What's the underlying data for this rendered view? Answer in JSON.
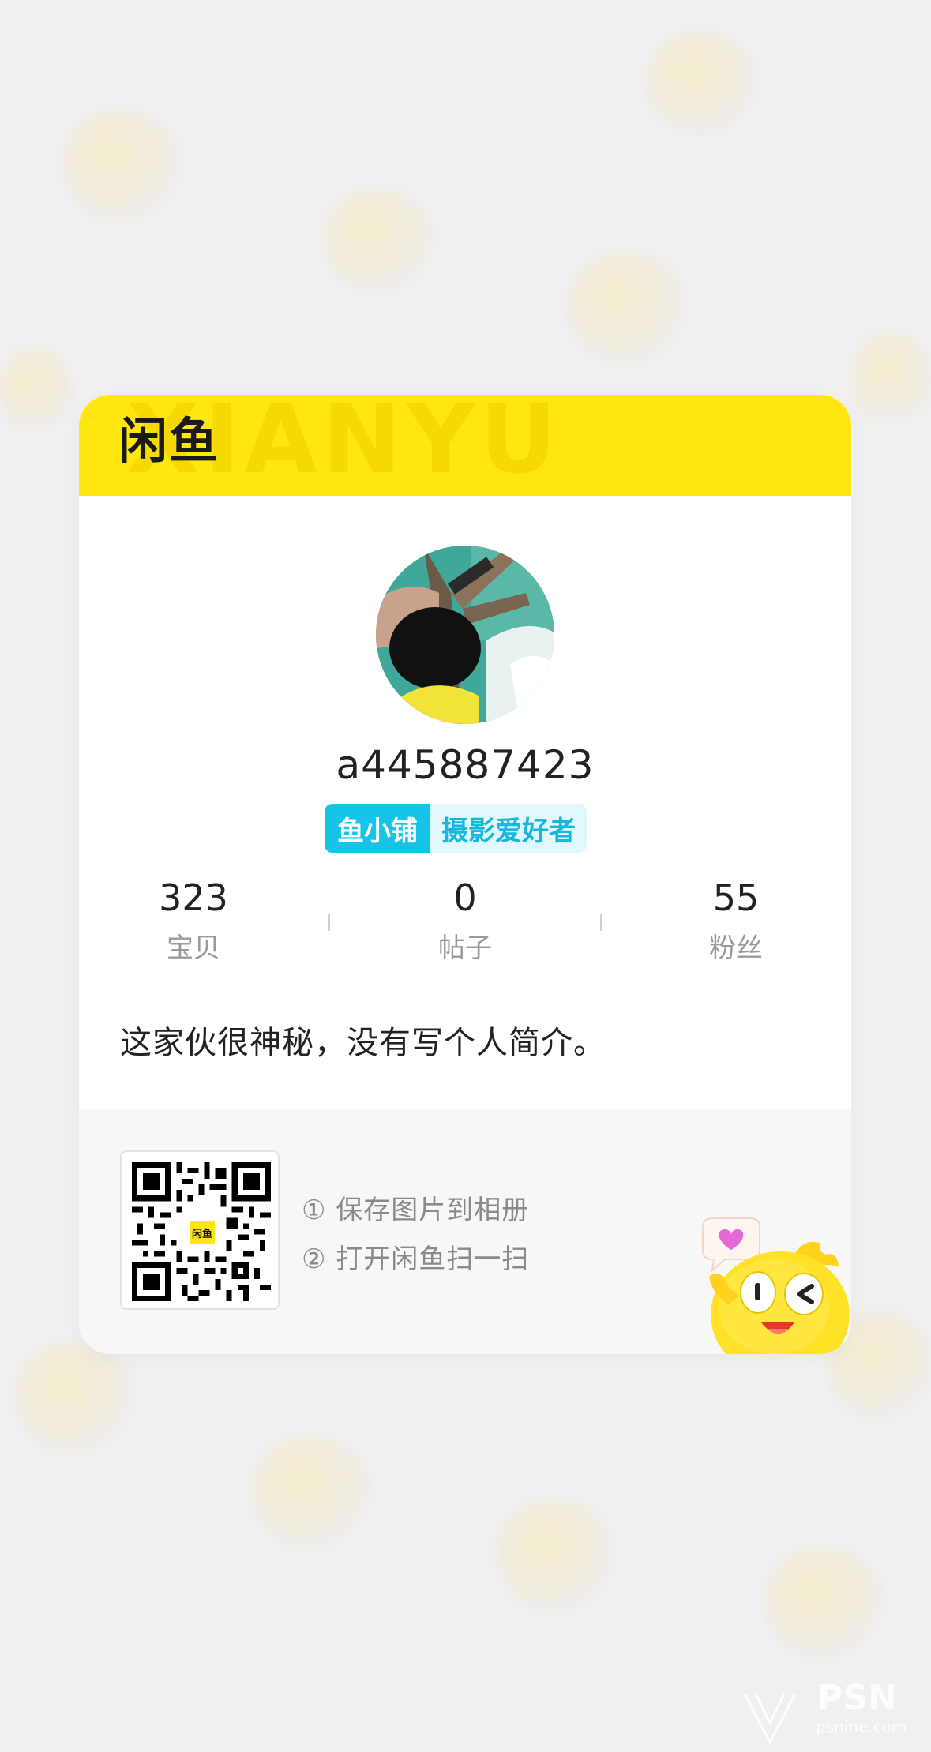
{
  "card": {
    "logo_text": "闲鱼",
    "header_watermark": "XIANYU",
    "username": "a445887423",
    "badge": {
      "shop_label": "鱼小铺",
      "tag_label": "摄影爱好者"
    },
    "stats": [
      {
        "value": "323",
        "label": "宝贝"
      },
      {
        "value": "0",
        "label": "帖子"
      },
      {
        "value": "55",
        "label": "粉丝"
      }
    ],
    "bio": "这家伙很神秘，没有写个人简介。",
    "qr_logo_text": "闲鱼",
    "steps": [
      "① 保存图片到相册",
      "② 打开闲鱼扫一扫"
    ]
  },
  "watermark": {
    "brand": "PSN",
    "sub": "psnine.com"
  },
  "colors": {
    "brand_yellow": "#ffe60f",
    "badge_blue": "#16c4e8",
    "background": "#f1f0f0"
  },
  "icons": {
    "mascot": "yellow-fish-mascot",
    "heart": "heart-speech-bubble-icon"
  }
}
